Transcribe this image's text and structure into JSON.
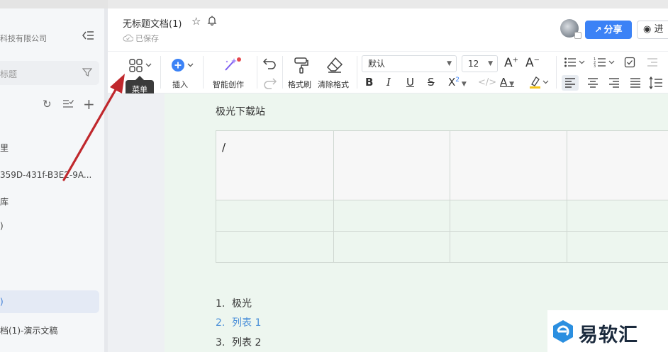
{
  "sidebar": {
    "company": "科技有限公司",
    "search_placeholder": "标题",
    "items": [
      {
        "label": "里"
      },
      {
        "label": "359D-431f-B3E2-9A..."
      },
      {
        "label": "库"
      },
      {
        "label": ")"
      },
      {
        "label": ")"
      },
      {
        "label": "档(1)-演示文稿"
      }
    ]
  },
  "header": {
    "title": "无标题文档(1)",
    "saved": "已保存",
    "share": "分享",
    "view": "进"
  },
  "toolbar": {
    "menu_tooltip": "菜单",
    "insert": "插入",
    "ai_create": "智能创作",
    "format_painter": "格式刷",
    "clear_format": "清除格式",
    "font_value": "默认",
    "size_value": "12"
  },
  "document": {
    "heading": "极光下载站",
    "table_cell_text": "/",
    "list": [
      {
        "number": "1.",
        "text": "极光"
      },
      {
        "number": "2.",
        "text": "列表 1"
      },
      {
        "number": "3.",
        "text": "列表 2"
      }
    ]
  },
  "watermark": {
    "text": "易软汇"
  },
  "colors": {
    "accent": "#3b82f6",
    "page_background": "#edf6ef",
    "annotation_arrow": "#c0282d"
  }
}
